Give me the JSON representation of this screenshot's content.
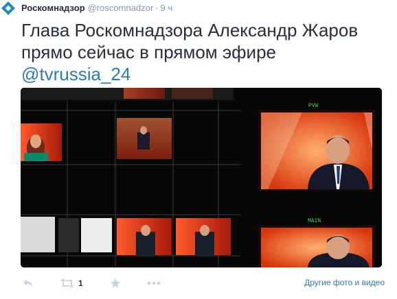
{
  "author": {
    "name": "Роскомнадзор",
    "handle": "@roscomnadzor",
    "separator": "·",
    "time": "9 ч"
  },
  "tweet": {
    "text": "Глава Роскомнадзора Александр Жаров прямо сейчас в прямом эфире",
    "mention": "@tvrussia_24"
  },
  "photo": {
    "labels": {
      "pvw": "PVW",
      "main": "MAIN"
    }
  },
  "actions": {
    "reply_icon": "reply-icon",
    "retweet_icon": "retweet-icon",
    "retweet_count": "1",
    "favorite_icon": "star-icon",
    "more_icon": "more-dots-icon",
    "media_link": "Другие фото и видео"
  },
  "colors": {
    "link": "#2b7bb9",
    "muted": "#8899a6",
    "action_icon": "#ccd6dd",
    "logo": "#1e88c8"
  }
}
